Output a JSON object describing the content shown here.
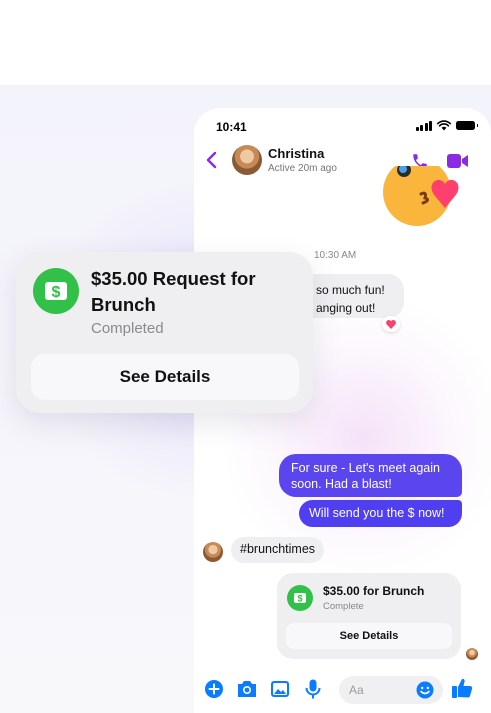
{
  "status_bar": {
    "time": "10:41"
  },
  "header": {
    "contact_name": "Christina",
    "contact_status": "Active 20m ago"
  },
  "messages": {
    "timestamp": "10:30 AM",
    "incoming_1_line1": "so much fun!",
    "incoming_1_line2": "anging out!",
    "outgoing_1": "For sure - Let's meet again soon. Had a blast!",
    "outgoing_2": "Will send you the $ now!",
    "hashtag": "#brunchtimes"
  },
  "payment_mini": {
    "title": "$35.00 for Brunch",
    "status": "Complete",
    "button_label": "See Details"
  },
  "payment_request": {
    "title": "$35.00 Request for Brunch",
    "status": "Completed",
    "button_label": "See Details"
  },
  "composer": {
    "placeholder": "Aa"
  },
  "colors": {
    "accent_purple": "#8a2be2",
    "outgoing_bubble": "#5a45ee",
    "cash_green": "#31c048",
    "composer_blue": "#0a7cff"
  }
}
